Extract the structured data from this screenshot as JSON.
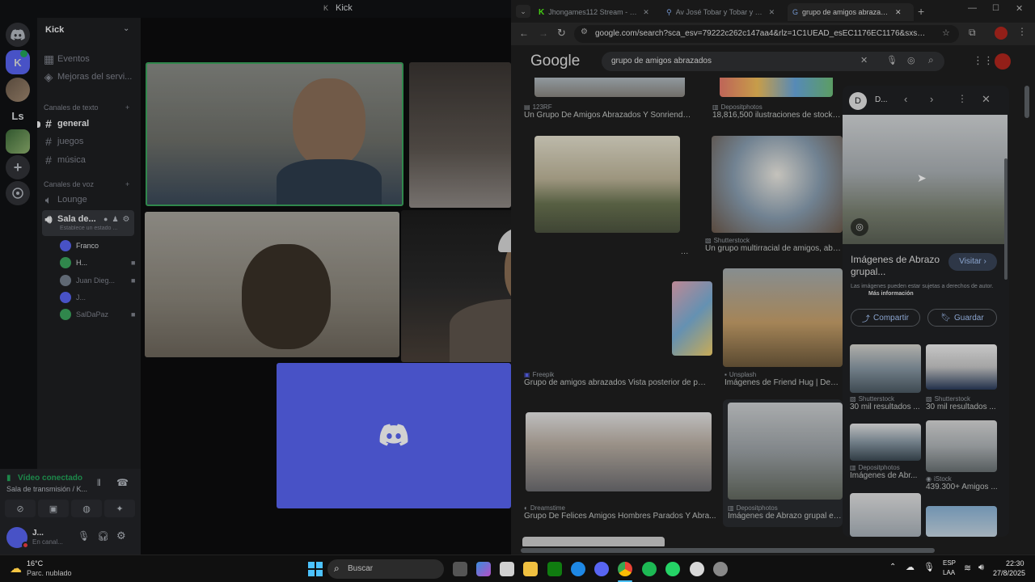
{
  "discord": {
    "window_title": "Kick",
    "server_name": "Kick",
    "server_letter": "K",
    "server_ls": "Ls",
    "nav": [
      {
        "label": "Eventos"
      },
      {
        "label": "Mejoras del servi..."
      }
    ],
    "text_header": "Canales de texto",
    "text_channels": [
      "general",
      "juegos",
      "música"
    ],
    "voice_header": "Canales de voz",
    "voice_channels": [
      "Lounge",
      "Sala de..."
    ],
    "voice_status": "Establece un estado ...",
    "voice_users": [
      "Franco",
      "H...",
      "Juan Dieg...",
      "J...",
      "SalDaPaz"
    ],
    "connection_status": "Vídeo conectado",
    "connection_channel": "Sala de transmisión / K...",
    "user_name": "J...",
    "user_status": "En canal..."
  },
  "browser": {
    "tabs": [
      {
        "title": "Jhongames112 Stream - Kick D..."
      },
      {
        "title": "Av José Tobar y Tobar y Gabrie..."
      },
      {
        "title": "grupo de amigos abrazados - G..."
      }
    ],
    "url": "google.com/search?sca_esv=79222c262c147aa4&rlz=1C1UEAD_esEC1176EC1176&sxsrf=AE3TifMY...",
    "logo": "Google",
    "search_query": "grupo de amigos abrazados",
    "results": [
      {
        "source": "123RF",
        "title": "Un Grupo De Amigos Abrazados Y Sonriendo ..."
      },
      {
        "source": "Depositphotos",
        "title": "18,816,500 ilustraciones de stock de ..."
      },
      {
        "source": "Shutterstock",
        "title": "Un grupo multirracial de amigos, abraza..."
      },
      {
        "source": "Freepik",
        "title": "Grupo de amigos abrazados Vista posterior de per..."
      },
      {
        "source": "Unsplash",
        "title": "Imágenes de Friend Hug | Descar..."
      },
      {
        "source": "Dreamstime",
        "title": "Grupo De Felices Amigos Hombres Parados Y Abra..."
      },
      {
        "source": "Depositphotos",
        "title": "Imágenes de Abrazo grupal espa..."
      }
    ],
    "partial_title": "...s",
    "panel": {
      "site_initial": "D...",
      "title": "Imágenes de Abrazo grupal...",
      "visit": "Visitar",
      "notice": "Las imágenes pueden estar sujetas a derechos de autor.",
      "more_info": "Más información",
      "share": "Compartir",
      "save": "Guardar",
      "related": [
        {
          "source": "Shutterstock",
          "title": "30 mil resultados ..."
        },
        {
          "source": "Shutterstock",
          "title": "30 mil resultados ..."
        },
        {
          "source": "Depositphotos",
          "title": "Imágenes de Abr..."
        },
        {
          "source": "iStock",
          "title": "439.300+ Amigos ..."
        }
      ]
    }
  },
  "taskbar": {
    "weather_temp": "16°C",
    "weather_desc": "Parc. nublado",
    "search_placeholder": "Buscar",
    "lang1": "ESP",
    "lang2": "LAA",
    "time": "22:30",
    "date": "27/8/2025"
  },
  "colors": {
    "discord_blurple": "#5865f2",
    "google_blue": "#8ab4f8",
    "online_green": "#23a55a"
  }
}
